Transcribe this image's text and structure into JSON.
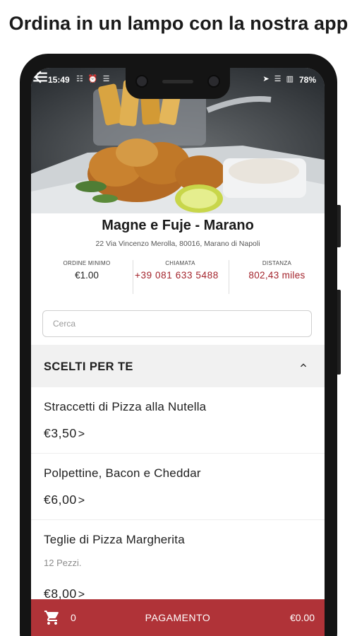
{
  "promo": {
    "title": "Ordina in un lampo con la nostra app"
  },
  "status_bar": {
    "time": "15:49",
    "left_icons": "☷ ⏰ ☰",
    "right_icons": "➤ ☰ ▥",
    "battery": "78%"
  },
  "icons": {
    "back": "arrow-back-icon",
    "menu": "hamburger-menu-icon",
    "collapse": "chevron-up-icon",
    "cart": "shopping-cart-icon"
  },
  "restaurant": {
    "name": "Magne e Fuje - Marano",
    "address": "22 Via Vincenzo Merolla, 80016, Marano di Napoli"
  },
  "stats": {
    "min_order_label": "ORDINE MINIMO",
    "min_order_value": "€1.00",
    "call_label": "CHIAMATA",
    "call_value": "+39 081 633 5488",
    "distance_label": "DISTANZA",
    "distance_value": "802,43  miles"
  },
  "search": {
    "placeholder": "Cerca"
  },
  "section": {
    "title": "SCELTI PER TE"
  },
  "items": [
    {
      "name": "Straccetti di Pizza alla Nutella",
      "price": "€3,50",
      "arrow": ">"
    },
    {
      "name": "Polpettine, Bacon e Cheddar",
      "price": "€6,00",
      "arrow": ">"
    },
    {
      "name": "Teglie di Pizza Margherita",
      "description": "12 Pezzi.",
      "price": "€8,00",
      "arrow": ">"
    }
  ],
  "cart": {
    "count": "0",
    "pay_label": "PAGAMENTO",
    "total": "€0.00"
  },
  "colors": {
    "accent": "#b03338",
    "price_red": "#a3232b"
  }
}
